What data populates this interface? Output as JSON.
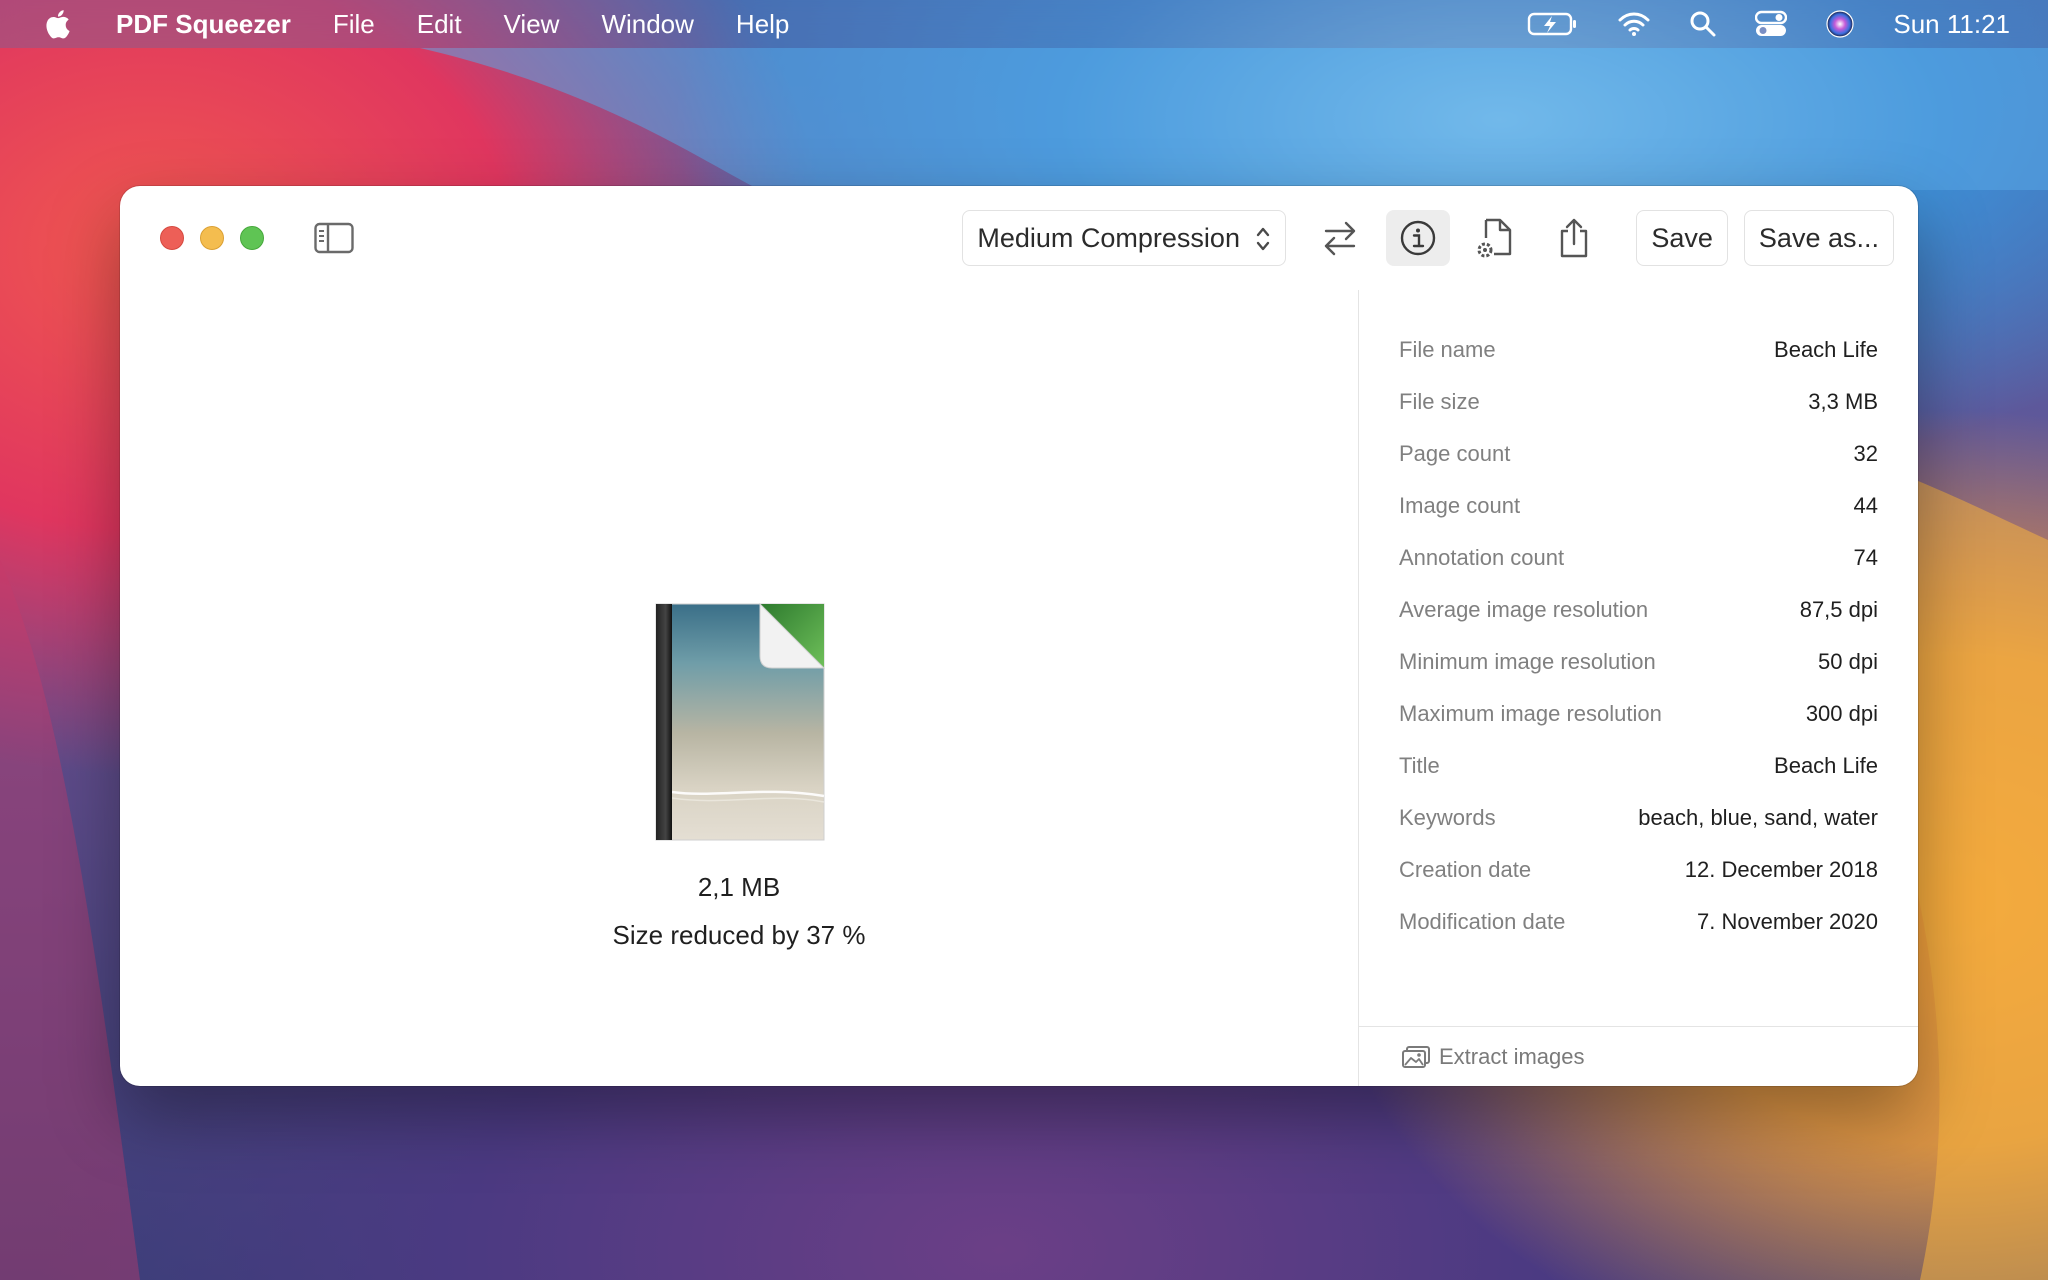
{
  "menubar": {
    "app_name": "PDF Squeezer",
    "items": [
      "File",
      "Edit",
      "View",
      "Window",
      "Help"
    ],
    "clock": "Sun 11:21"
  },
  "toolbar": {
    "compression_label": "Medium Compression",
    "save_label": "Save",
    "save_as_label": "Save as..."
  },
  "document": {
    "result_size": "2,1 MB",
    "reduction_text": "Size reduced by 37 %"
  },
  "info": {
    "rows": [
      {
        "label": "File name",
        "value": "Beach Life"
      },
      {
        "label": "File size",
        "value": "3,3 MB"
      },
      {
        "label": "Page count",
        "value": "32"
      },
      {
        "label": "Image count",
        "value": "44"
      },
      {
        "label": "Annotation count",
        "value": "74"
      },
      {
        "label": "Average image resolution",
        "value": "87,5 dpi"
      },
      {
        "label": "Minimum image resolution",
        "value": "50 dpi"
      },
      {
        "label": "Maximum image resolution",
        "value": "300 dpi"
      },
      {
        "label": "Title",
        "value": "Beach Life"
      },
      {
        "label": "Keywords",
        "value": "beach, blue, sand, water"
      },
      {
        "label": "Creation date",
        "value": "12. December 2018"
      },
      {
        "label": "Modification date",
        "value": "7. November 2020"
      }
    ],
    "extract_label": "Extract images"
  }
}
